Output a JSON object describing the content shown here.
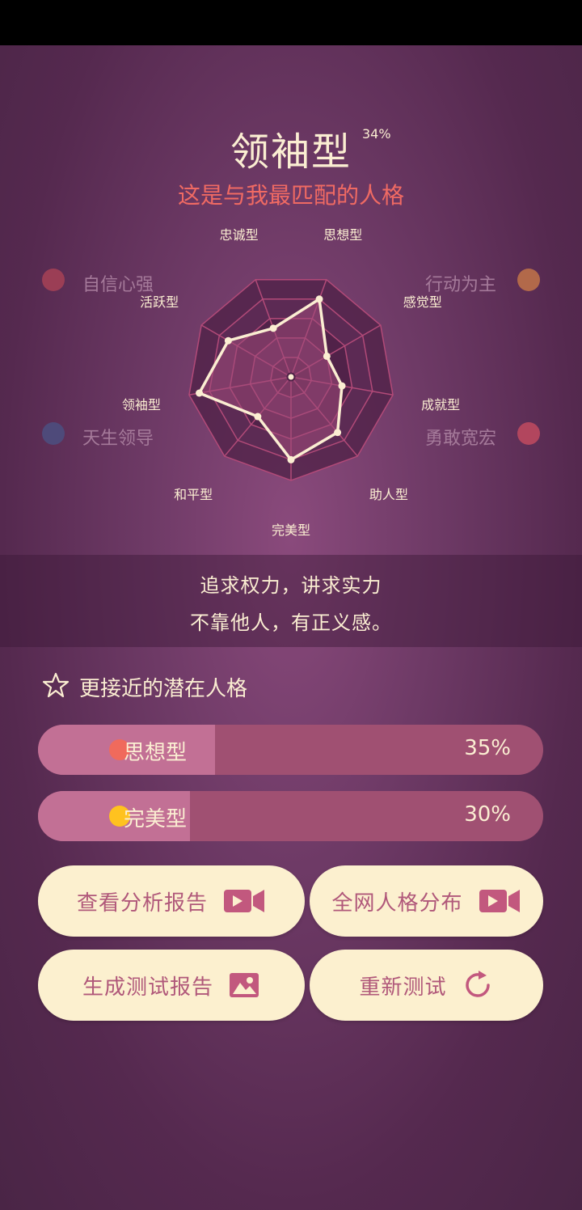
{
  "result": {
    "title": "领袖型",
    "percent": "34%",
    "subtitle": "这是与我最匹配的人格"
  },
  "traits": [
    {
      "label": "自信心强",
      "color": "#9b3e55"
    },
    {
      "label": "行动为主",
      "color": "#b2694a"
    },
    {
      "label": "天生领导",
      "color": "#4e4a7a"
    },
    {
      "label": "勇敢宽宏",
      "color": "#b2465e"
    }
  ],
  "chart_data": {
    "type": "radar",
    "axes": [
      "思想型",
      "感觉型",
      "成就型",
      "助人型",
      "完美型",
      "和平型",
      "领袖型",
      "活跃型",
      "忠诚型"
    ],
    "values": [
      0.8,
      0.4,
      0.5,
      0.7,
      0.8,
      0.5,
      0.9,
      0.7,
      0.5
    ],
    "rings": 5
  },
  "description": {
    "line1": "追求权力，讲求实力",
    "line2": "不靠他人，有正义感。"
  },
  "potential": {
    "heading": "更接近的潜在人格",
    "items": [
      {
        "name": "思想型",
        "percent": "35%",
        "value": 0.35,
        "dot_color": "#f06a5c"
      },
      {
        "name": "完美型",
        "percent": "30%",
        "value": 0.3,
        "dot_color": "#ffc21f"
      }
    ]
  },
  "buttons": {
    "analysis_report": "查看分析报告",
    "distribution": "全网人格分布",
    "generate_report": "生成测试报告",
    "retest": "重新测试"
  }
}
